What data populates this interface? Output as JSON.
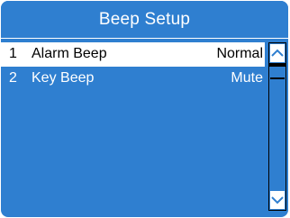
{
  "header": {
    "title": "Beep Setup"
  },
  "items": [
    {
      "number": "1",
      "label": "Alarm Beep",
      "value": "Normal",
      "selected": true
    },
    {
      "number": "2",
      "label": "Key Beep",
      "value": "Mute",
      "selected": false
    }
  ],
  "scrollbar": {
    "up_icon": "chevron-up-icon",
    "down_icon": "chevron-down-icon"
  },
  "colors": {
    "background": "#2f7fd0",
    "highlight": "#ffffff",
    "text": "#ffffff",
    "highlight_text": "#000000"
  }
}
